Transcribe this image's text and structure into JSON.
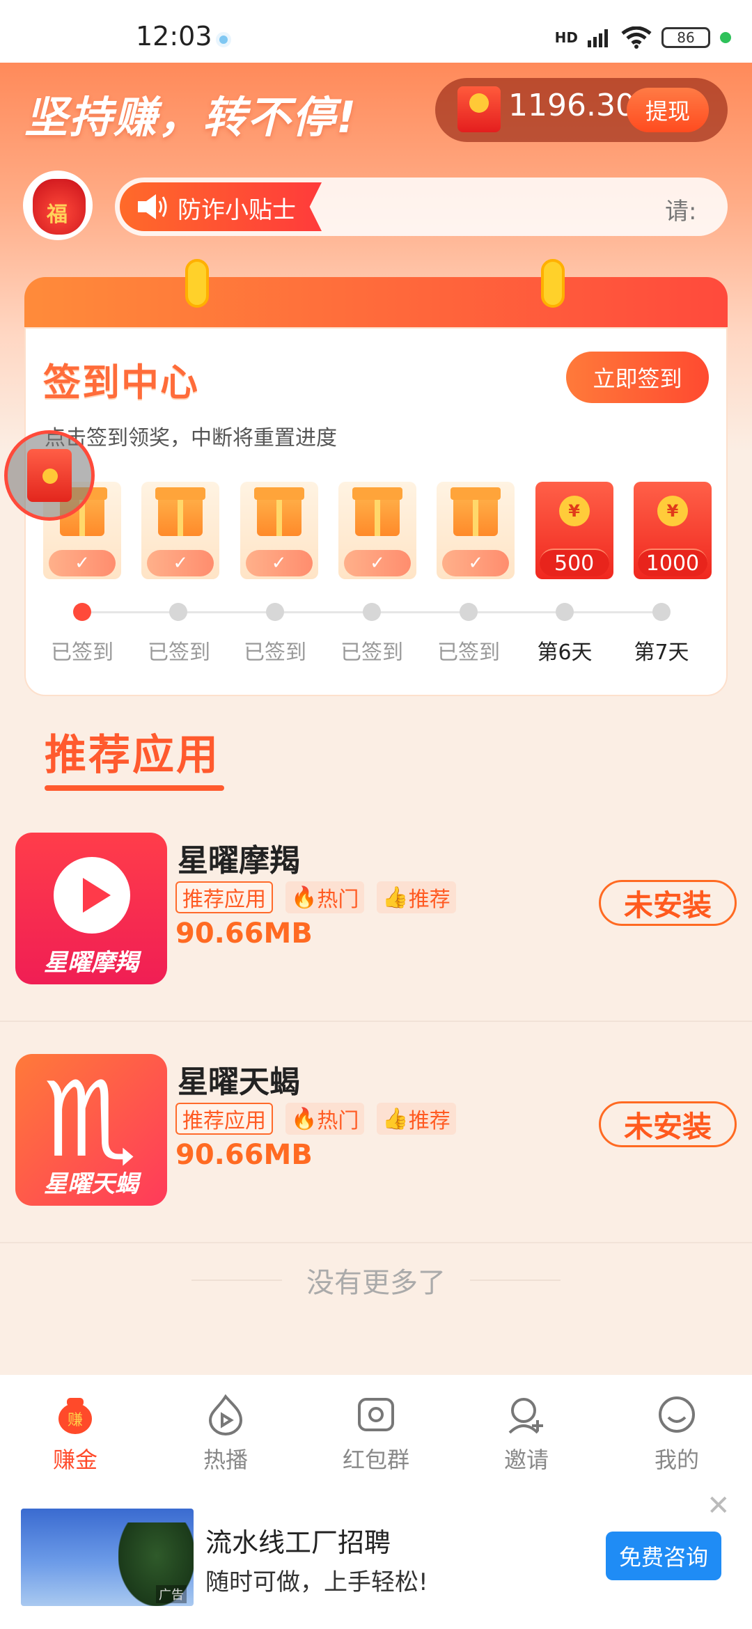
{
  "status_bar": {
    "time": "12:03",
    "battery": "86",
    "network": "HD"
  },
  "header": {
    "slogan": "坚持赚，转不停!",
    "balance": "1196.30",
    "withdraw_label": "提现"
  },
  "tips": {
    "tag_label": "防诈小贴士",
    "scroll_text": "请:"
  },
  "checkin": {
    "title": "签到中心",
    "button_label": "立即签到",
    "subtitle": "点击签到领奖，中断将重置进度",
    "days": [
      {
        "type": "gift",
        "reward": "✓",
        "label": "已签到",
        "status": "signed"
      },
      {
        "type": "gift",
        "reward": "✓",
        "label": "已签到",
        "status": "signed"
      },
      {
        "type": "gift",
        "reward": "✓",
        "label": "已签到",
        "status": "signed"
      },
      {
        "type": "gift",
        "reward": "✓",
        "label": "已签到",
        "status": "signed"
      },
      {
        "type": "gift",
        "reward": "✓",
        "label": "已签到",
        "status": "signed"
      },
      {
        "type": "redpacket",
        "reward": "500",
        "label": "第6天",
        "status": "future"
      },
      {
        "type": "redpacket",
        "reward": "1000",
        "label": "第7天",
        "status": "future"
      }
    ]
  },
  "recommend": {
    "title": "推荐应用",
    "apps": [
      {
        "name": "星曜摩羯",
        "icon_caption": "星曜摩羯",
        "tags": [
          "推荐应用",
          "热门",
          "推荐"
        ],
        "size": "90.66MB",
        "action": "未安装"
      },
      {
        "name": "星曜天蝎",
        "icon_caption": "星曜天蝎",
        "tags": [
          "推荐应用",
          "热门",
          "推荐"
        ],
        "size": "90.66MB",
        "action": "未安装"
      }
    ],
    "end_text": "没有更多了"
  },
  "nav": {
    "items": [
      {
        "label": "赚金",
        "icon": "money-bag-icon",
        "active": true
      },
      {
        "label": "热播",
        "icon": "play-flame-icon",
        "active": false
      },
      {
        "label": "红包群",
        "icon": "group-chat-icon",
        "active": false
      },
      {
        "label": "邀请",
        "icon": "invite-user-icon",
        "active": false
      },
      {
        "label": "我的",
        "icon": "profile-icon",
        "active": false
      }
    ]
  },
  "ad": {
    "title": "流水线工厂招聘",
    "description": "随时可做，上手轻松!",
    "button_label": "免费咨询",
    "ad_mark": "广告"
  },
  "colors": {
    "brand": "#ff5a2e",
    "accent": "#ff4a3a",
    "ad_button": "#1f8cf5",
    "background": "#fbeee4"
  }
}
